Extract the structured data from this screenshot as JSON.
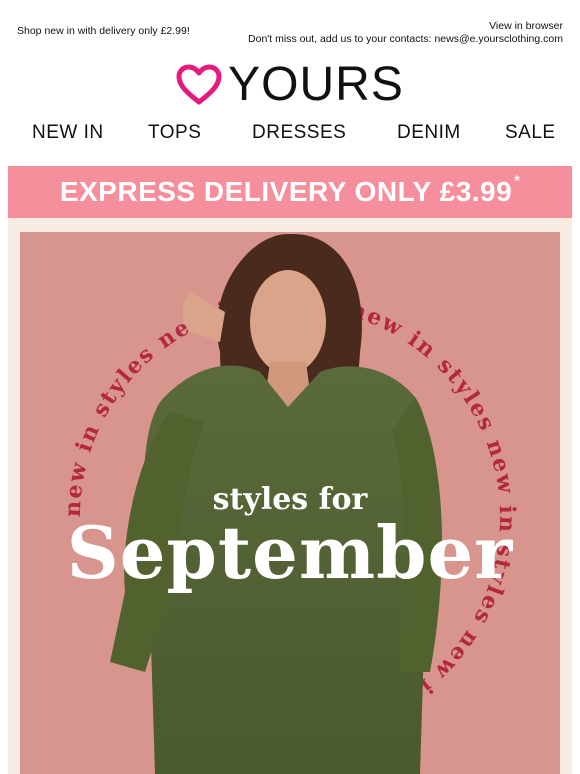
{
  "preheader": {
    "left_text": "Shop new in with delivery only £2.99!",
    "view_in_browser": "View in browser",
    "contacts_note": "Don't miss out, add us to your contacts: news@e.yoursclothing.com"
  },
  "logo": {
    "text": "YOURS",
    "heart_color": "#e5197e"
  },
  "nav": [
    "NEW IN",
    "TOPS",
    "DRESSES",
    "DENIM",
    "SALE"
  ],
  "banner": {
    "text": "EXPRESS DELIVERY ONLY £3.99",
    "asterisk": "*",
    "color": "#f68f9c"
  },
  "hero": {
    "ring_text": "new in styles",
    "title_small": "styles for",
    "title_large": "September",
    "background_color": "#d8958e",
    "ring_color": "#b3283f",
    "image_subject": "woman in olive green oversized v-neck jumper"
  }
}
